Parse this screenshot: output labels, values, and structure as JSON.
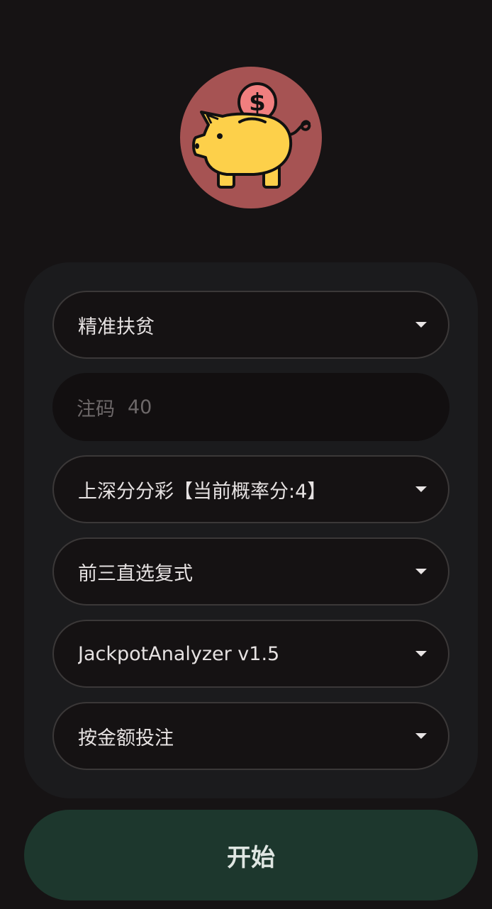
{
  "logo": {
    "icon": "piggy-bank-icon",
    "bg_color": "#a65353"
  },
  "form": {
    "plan_select": "精准扶贫",
    "bet_input": {
      "label": "注码",
      "placeholder": "40",
      "value": ""
    },
    "lottery_select": "上深分分彩【当前概率分:4】",
    "play_select": "前三直选复式",
    "analyzer_select": "JackpotAnalyzer v1.5",
    "mode_select": "按金额投注"
  },
  "start_button": {
    "label": "开始",
    "color": "#1d372d"
  }
}
